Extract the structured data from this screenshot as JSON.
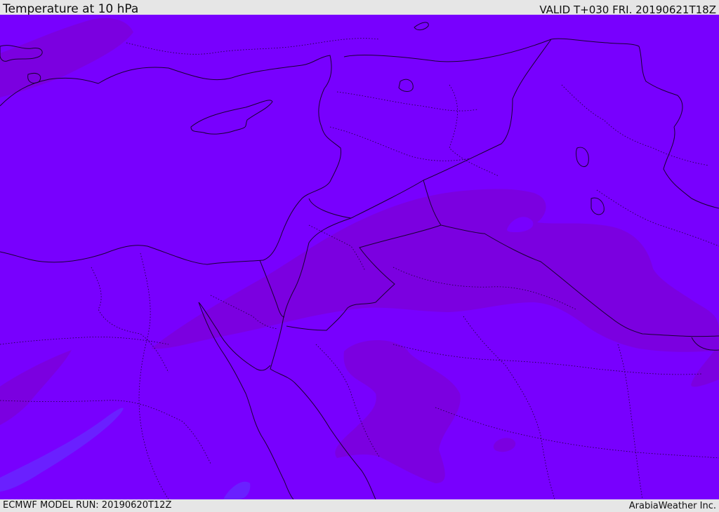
{
  "header": {
    "title": "Temperature at 10 hPa",
    "valid": "VALID T+030 FRI. 20190621T18Z"
  },
  "footer": {
    "model_run": "ECMWF MODEL RUN: 20190620T12Z",
    "credit": "ArabiaWeather Inc."
  },
  "map": {
    "field": "temperature",
    "level": "10 hPa",
    "background_color": "#7800fe",
    "shade_warm_color": "#7b00e0",
    "shade_cool_color": "#6a20ff",
    "coastline_color": "#1a0033",
    "border_style": "dotted"
  }
}
